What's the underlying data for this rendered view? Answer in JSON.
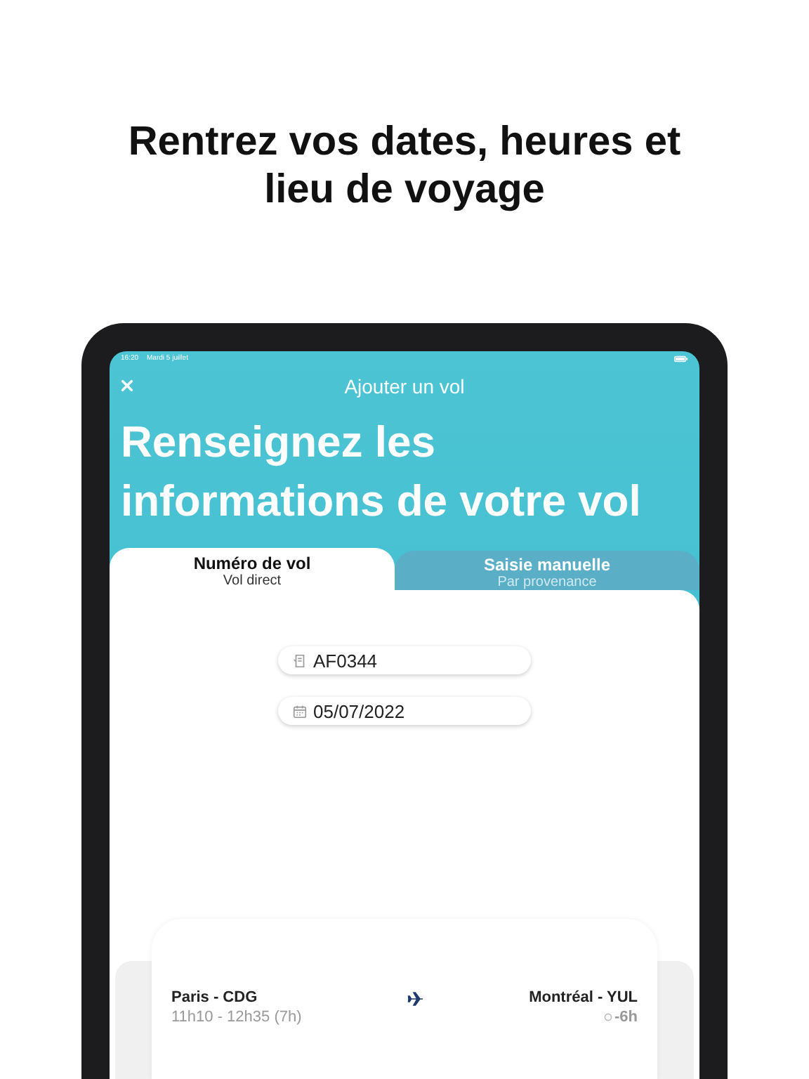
{
  "headline": "Rentrez vos dates, heures et lieu de voyage",
  "status_bar": {
    "time": "16:20",
    "date": "Mardi 5 juillet"
  },
  "nav": {
    "title": "Ajouter un vol"
  },
  "heading": "Renseignez les informations de votre vol",
  "tabs": [
    {
      "label": "Numéro de vol",
      "sublabel": "Vol direct",
      "selected": true
    },
    {
      "label": "Saisie manuelle",
      "sublabel": "Par provenance",
      "selected": false
    }
  ],
  "fields": [
    {
      "kind": "flight",
      "value": "AF0344"
    },
    {
      "kind": "date",
      "value": "05/07/2022"
    }
  ],
  "flight": {
    "origin": "Paris - CDG",
    "times": "11h10 - 12h35 (7h)",
    "destination": "Montréal - YUL",
    "offset": "-6h"
  }
}
